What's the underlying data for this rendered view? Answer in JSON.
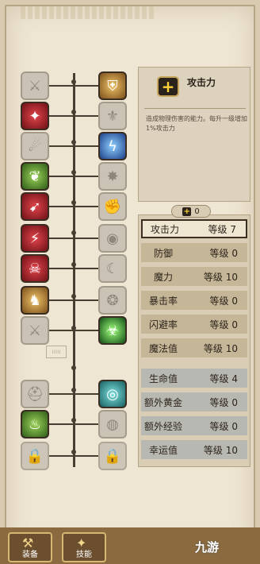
{
  "nodes_left": [
    {
      "name": "swords-icon",
      "glyph": "⚔",
      "state": "off"
    },
    {
      "name": "strike-icon",
      "glyph": "✦",
      "state": "on",
      "color": "red"
    },
    {
      "name": "claw-icon",
      "glyph": "☄",
      "state": "off"
    },
    {
      "name": "nature-icon",
      "glyph": "❦",
      "state": "on",
      "color": "green"
    },
    {
      "name": "dash-icon",
      "glyph": "➹",
      "state": "on",
      "color": "red"
    },
    {
      "name": "blade-icon",
      "glyph": "⚡",
      "state": "on",
      "color": "red"
    },
    {
      "name": "shadow-icon",
      "glyph": "☠",
      "state": "on",
      "color": "red"
    },
    {
      "name": "beast-icon",
      "glyph": "♞",
      "state": "on",
      "color": "gold"
    },
    {
      "name": "crossed-swords-icon",
      "glyph": "⚔",
      "state": "off"
    },
    {
      "name": "helmet-icon",
      "glyph": "⛑",
      "state": "off"
    },
    {
      "name": "cauldron-icon",
      "glyph": "♨",
      "state": "on",
      "color": "green"
    },
    {
      "name": "lock-icon",
      "glyph": "🔒",
      "state": "locked"
    }
  ],
  "nodes_right": [
    {
      "name": "shield-emblem-icon",
      "glyph": "⛨",
      "state": "on",
      "color": "gold"
    },
    {
      "name": "helm-icon",
      "glyph": "⚜",
      "state": "off"
    },
    {
      "name": "lightning-icon",
      "glyph": "ϟ",
      "state": "on",
      "color": "blue"
    },
    {
      "name": "cannon-icon",
      "glyph": "✸",
      "state": "off"
    },
    {
      "name": "fist-icon",
      "glyph": "✊",
      "state": "off"
    },
    {
      "name": "eye-icon",
      "glyph": "◉",
      "state": "off"
    },
    {
      "name": "crescent-icon",
      "glyph": "☾",
      "state": "off"
    },
    {
      "name": "orb-icon",
      "glyph": "❂",
      "state": "off"
    },
    {
      "name": "poison-icon",
      "glyph": "☣",
      "state": "on",
      "color": "lime"
    },
    {
      "name": "rune-eye-icon",
      "glyph": "◎",
      "state": "on",
      "color": "teal"
    },
    {
      "name": "rune-stone-icon",
      "glyph": "◍",
      "state": "off"
    },
    {
      "name": "lock-icon",
      "glyph": "🔒",
      "state": "locked"
    }
  ],
  "spine_mark": "ııııı",
  "info": {
    "icon": "+",
    "title": "攻击力",
    "description": "造成物理伤害的能力。每升一级增加1%攻击力"
  },
  "points": {
    "icon": "+",
    "value": "0"
  },
  "stats": [
    {
      "name": "攻击力",
      "level": "等级 7",
      "selected": true,
      "tone": "sel"
    },
    {
      "name": "防御",
      "level": "等级 0",
      "tone": "hi"
    },
    {
      "name": "魔力",
      "level": "等级 10",
      "tone": "hi"
    },
    {
      "name": "暴击率",
      "level": "等级 0",
      "tone": "hi"
    },
    {
      "name": "闪避率",
      "level": "等级 0",
      "tone": "hi"
    },
    {
      "name": "魔法值",
      "level": "等级 10",
      "tone": "hi"
    },
    {
      "name": "生命值",
      "level": "等级 4",
      "tone": "lo"
    },
    {
      "name": "额外黄金",
      "level": "等级 0",
      "tone": "lo"
    },
    {
      "name": "额外经验",
      "level": "等级 0",
      "tone": "lo"
    },
    {
      "name": "幸运值",
      "level": "等级 10",
      "tone": "lo"
    }
  ],
  "footer": {
    "tabs": [
      {
        "label": "装备",
        "icon": "⚒"
      },
      {
        "label": "技能",
        "icon": "✦"
      }
    ],
    "watermark": "九游"
  }
}
